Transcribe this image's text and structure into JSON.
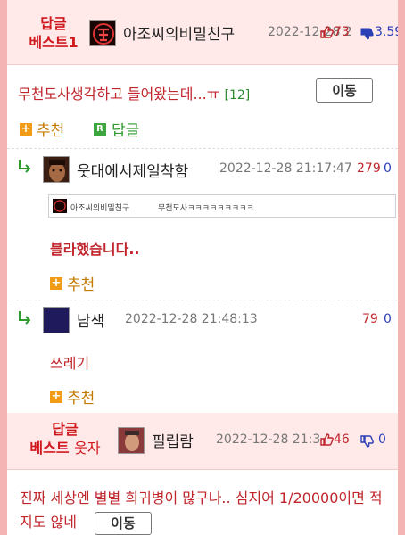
{
  "best1": {
    "label_line1": "답글",
    "label_line2": "베스트1",
    "nickname": "아조씨의비밀친구",
    "date": "2022-12-28 2",
    "up_count": "73",
    "down_count": "3.59",
    "title": "무천도사생각하고 들어왔는데...ㅠ",
    "comment_count": "[12]",
    "move_button": "이동",
    "recommend_label": "추천",
    "reply_label": "답글"
  },
  "replies": [
    {
      "nickname": "웃대에서제일착함",
      "date": "2022-12-28 21:17:47",
      "up_count": "279",
      "down_count": "0",
      "quote_nick": "아조씨의비밀친구",
      "quote_text": "무천도사ㅋㅋㅋㅋㅋㅋㅋㅋㅋ",
      "body": "블라했습니다..",
      "recommend_label": "추천"
    },
    {
      "nickname": "남색",
      "date": "2022-12-28 21:48:13",
      "up_count": "79",
      "down_count": "0",
      "body": "쓰레기",
      "recommend_label": "추천"
    }
  ],
  "best2": {
    "label_line1": "답글",
    "label_line2_a": "베스트",
    "label_line2_b": "웃자",
    "nickname": "필립람",
    "date": "2022-12-28 21:3",
    "up_count": "46",
    "down_count": "0",
    "title": "진짜 세상엔 별별 희귀병이 많구나.. 심지어 1/20000이면 적지도 않네",
    "move_button": "이동"
  },
  "colors": {
    "accent_red": "#d0191f",
    "best_bg": "#ffe9e9",
    "outer_bg": "#f4b4b4",
    "green": "#2e8b2e",
    "blue": "#2b3fb6",
    "orange": "#f29b16"
  },
  "icons": {
    "thumb_up": "thumbs-up-icon",
    "thumb_down": "thumbs-down-icon",
    "reply_arrow": "reply-arrow-icon",
    "plus": "plus-icon",
    "reply_r": "reply-r-icon"
  }
}
